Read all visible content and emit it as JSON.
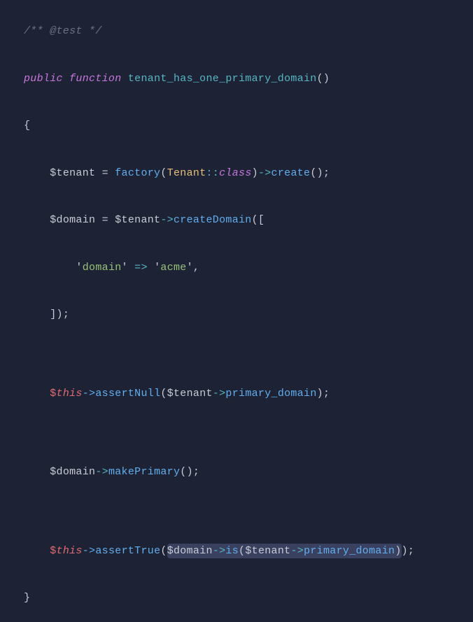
{
  "code": {
    "l1_comment": "/** @test */",
    "l2_public": "public",
    "l2_function": "function",
    "l2_name": "tenant_has_one_primary_domain",
    "l2_paren": "()",
    "l3_brace": "{",
    "l4_v_tenant": "$tenant",
    "l4_eq": " = ",
    "l4_factory": "factory",
    "l4_p1": "(",
    "l4_tenant_cls": "Tenant",
    "l4_dcolon": "::",
    "l4_class": "class",
    "l4_p2": ")",
    "l4_arrow": "->",
    "l4_create": "create",
    "l4_p3": "();",
    "l5_v_domain": "$domain",
    "l5_eq": " = ",
    "l5_v_tenant": "$tenant",
    "l5_arrow": "->",
    "l5_createDomain": "createDomain",
    "l5_p1": "([",
    "l6_q1": "'",
    "l6_key": "domain",
    "l6_q2": "'",
    "l6_fat": " => ",
    "l6_q3": "'",
    "l6_val": "acme",
    "l6_q4": "'",
    "l6_comma": ",",
    "l7_close": "]);",
    "l8_d": "$",
    "l8_this": "this",
    "l8_arrow": "->",
    "l8_assertNull": "assertNull",
    "l8_p1": "(",
    "l8_v_tenant": "$tenant",
    "l8_arrow2": "->",
    "l8_pd": "primary_domain",
    "l8_p2": ");",
    "l9_v_domain": "$domain",
    "l9_arrow": "->",
    "l9_makePrimary": "makePrimary",
    "l9_p": "();",
    "l10_d": "$",
    "l10_this": "this",
    "l10_arrow": "->",
    "l10_assertTrue": "assertTrue",
    "l10_p1": "(",
    "l10_v_domain": "$domain",
    "l10_arrow2": "->",
    "l10_is": "is",
    "l10_p2": "(",
    "l10_v_tenant": "$tenant",
    "l10_arrow3": "->",
    "l10_pd": "primary_domain",
    "l10_p3": ")",
    "l10_p4": ");",
    "l11_brace": "}"
  }
}
